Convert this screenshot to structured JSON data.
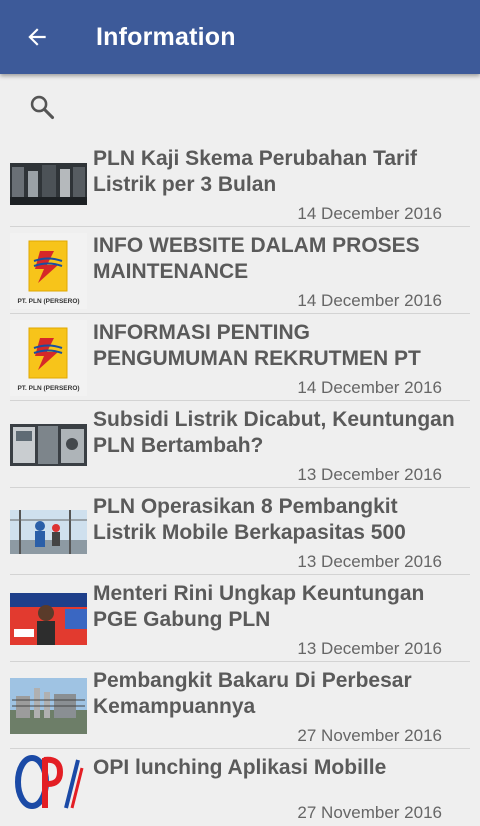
{
  "appbar": {
    "title": "Information",
    "back_icon": "arrow-left-icon"
  },
  "search": {
    "icon": "search-icon"
  },
  "items": [
    {
      "line1": "PLN Kaji Skema Perubahan Tarif",
      "line2": "Listrik per 3 Bulan",
      "date": "14 December 2016",
      "thumb": "photo-machinery"
    },
    {
      "line1": "INFO WEBSITE DALAM PROSES",
      "line2": "MAINTENANCE",
      "date": "14 December 2016",
      "thumb": "pln-logo",
      "logo_caption": "PT. PLN (PERSERO)"
    },
    {
      "line1": "INFORMASI PENTING",
      "line2": "PENGUMUMAN REKRUTMEN PT",
      "date": "14 December 2016",
      "thumb": "pln-logo",
      "logo_caption": "PT. PLN (PERSERO)"
    },
    {
      "line1": "Subsidi Listrik Dicabut, Keuntungan",
      "line2": "PLN Bertambah?",
      "date": "13 December 2016",
      "thumb": "photo-meters"
    },
    {
      "line1": "PLN Operasikan 8 Pembangkit",
      "line2": "Listrik Mobile Berkapasitas 500",
      "date": "13 December 2016",
      "thumb": "photo-workers"
    },
    {
      "line1": "Menteri Rini Ungkap Keuntungan",
      "line2": "PGE Gabung PLN",
      "date": "13 December 2016",
      "thumb": "photo-speaker"
    },
    {
      "line1": "Pembangkit Bakaru Di Perbesar",
      "line2": "Kemampuannya",
      "date": "27 November 2016",
      "thumb": "photo-plant"
    },
    {
      "line1": "OPI lunching Aplikasi Mobille",
      "line2": "",
      "date": "27 November 2016",
      "thumb": "opi-logo"
    }
  ]
}
